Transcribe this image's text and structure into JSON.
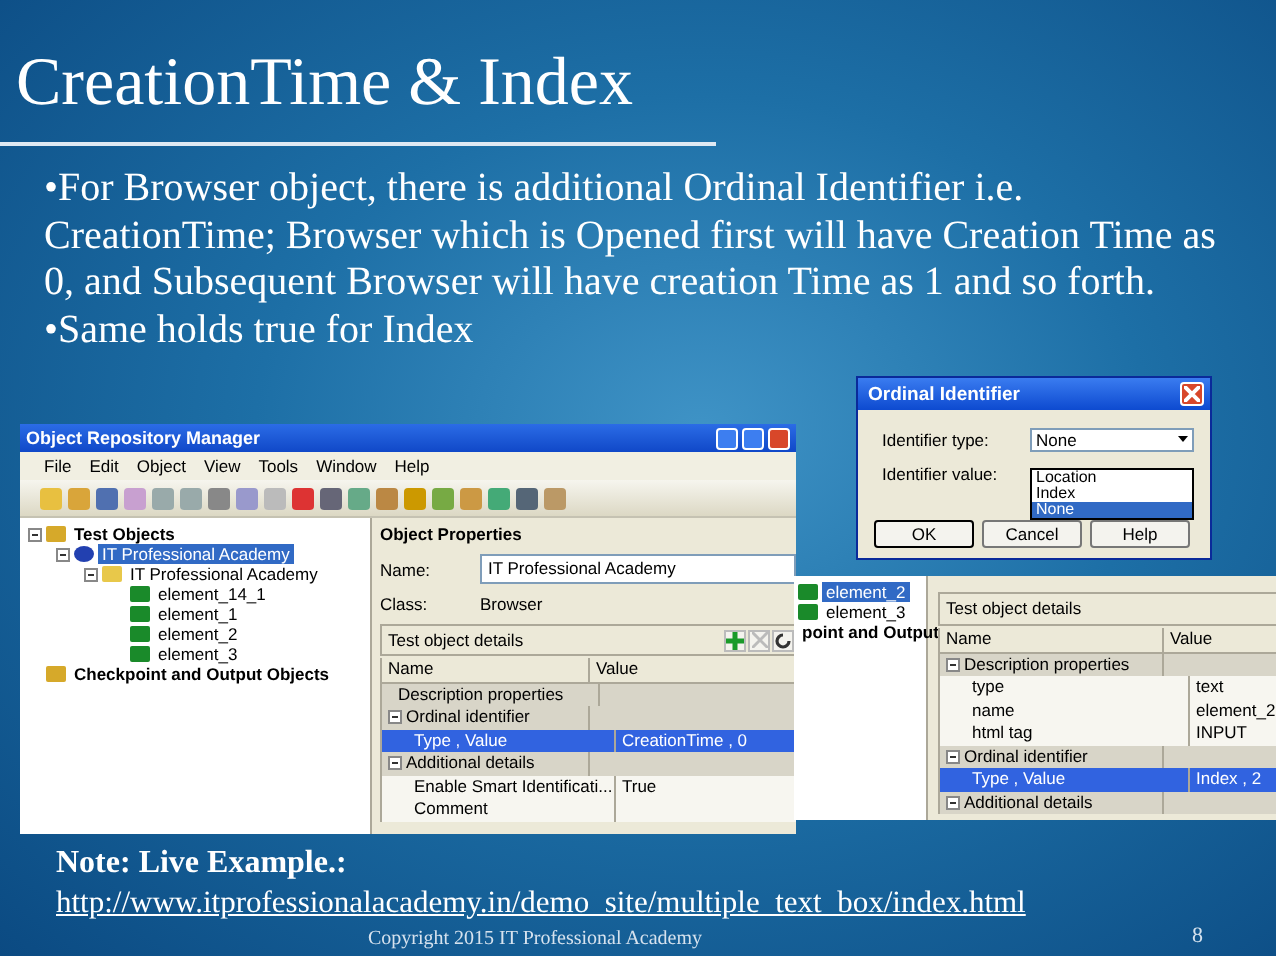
{
  "title": "CreationTime & Index",
  "bullets": [
    "•For Browser object, there is additional Ordinal Identifier i.e. CreationTime; Browser which is Opened first will have Creation Time as 0, and Subsequent Browser will have creation Time as 1 and so forth.",
    "•Same holds true for Index"
  ],
  "main_window": {
    "title": "Object Repository Manager",
    "menu": [
      "File",
      "Edit",
      "Object",
      "View",
      "Tools",
      "Window",
      "Help"
    ],
    "tree": [
      {
        "label": "Test Objects",
        "selected": false,
        "children": [
          {
            "label": "IT Professional Academy",
            "selected": true,
            "children": [
              {
                "label": "IT Professional Academy",
                "selected": false,
                "children": [
                  {
                    "label": "element_14_1",
                    "selected": false
                  },
                  {
                    "label": "element_1",
                    "selected": false
                  },
                  {
                    "label": "element_2",
                    "selected": false
                  },
                  {
                    "label": "element_3",
                    "selected": false
                  }
                ]
              }
            ]
          }
        ]
      },
      {
        "label": "Checkpoint and Output Objects",
        "selected": false
      }
    ],
    "properties_title": "Object Properties",
    "name_label": "Name:",
    "name_value": "IT Professional Academy",
    "class_label": "Class:",
    "class_value": "Browser",
    "details_title": "Test object details",
    "columns": [
      "Name",
      "Value"
    ],
    "rows": [
      {
        "kind": "label",
        "name": "Description properties",
        "value": "",
        "selected": false
      },
      {
        "kind": "group",
        "name": "Ordinal identifier",
        "value": "",
        "selected": false
      },
      {
        "kind": "property",
        "name": "Type , Value",
        "value": "CreationTime , 0",
        "selected": true
      },
      {
        "kind": "group",
        "name": "Additional details",
        "value": "",
        "selected": false
      },
      {
        "kind": "property",
        "name": "Enable Smart Identificati...",
        "value": "True",
        "selected": false
      },
      {
        "kind": "property",
        "name": "Comment",
        "value": "",
        "selected": false
      }
    ]
  },
  "dialog": {
    "title": "Ordinal Identifier",
    "type_label": "Identifier type:",
    "type_value": "None",
    "value_label": "Identifier value:",
    "options": [
      {
        "label": "Location",
        "selected": false
      },
      {
        "label": "Index",
        "selected": false
      },
      {
        "label": "None",
        "selected": true
      }
    ],
    "buttons": [
      "OK",
      "Cancel",
      "Help"
    ]
  },
  "second_window": {
    "tree": [
      {
        "label": "element_2",
        "selected": true
      },
      {
        "label": "element_3",
        "selected": false
      },
      {
        "label": "point and Output",
        "selected": false
      }
    ],
    "details_title": "Test object details",
    "columns": [
      "Name",
      "Value"
    ],
    "rows": [
      {
        "kind": "group",
        "name": "Description properties",
        "value": "",
        "selected": false
      },
      {
        "kind": "property",
        "name": "type",
        "value": "text",
        "selected": false
      },
      {
        "kind": "property",
        "name": "name",
        "value": "element_2",
        "selected": false
      },
      {
        "kind": "property",
        "name": "html tag",
        "value": "INPUT",
        "selected": false
      },
      {
        "kind": "group",
        "name": "Ordinal identifier",
        "value": "",
        "selected": false
      },
      {
        "kind": "property",
        "name": "Type , Value",
        "value": "Index , 2",
        "selected": true
      },
      {
        "kind": "group",
        "name": "Additional details",
        "value": "",
        "selected": false
      }
    ]
  },
  "note": {
    "label": "Note: Live Example.:",
    "link": "http://www.itprofessionalacademy.in/demo_site/multiple_text_box/index.html"
  },
  "copyright": "Copyright 2015 IT Professional Academy",
  "page_number": "8"
}
